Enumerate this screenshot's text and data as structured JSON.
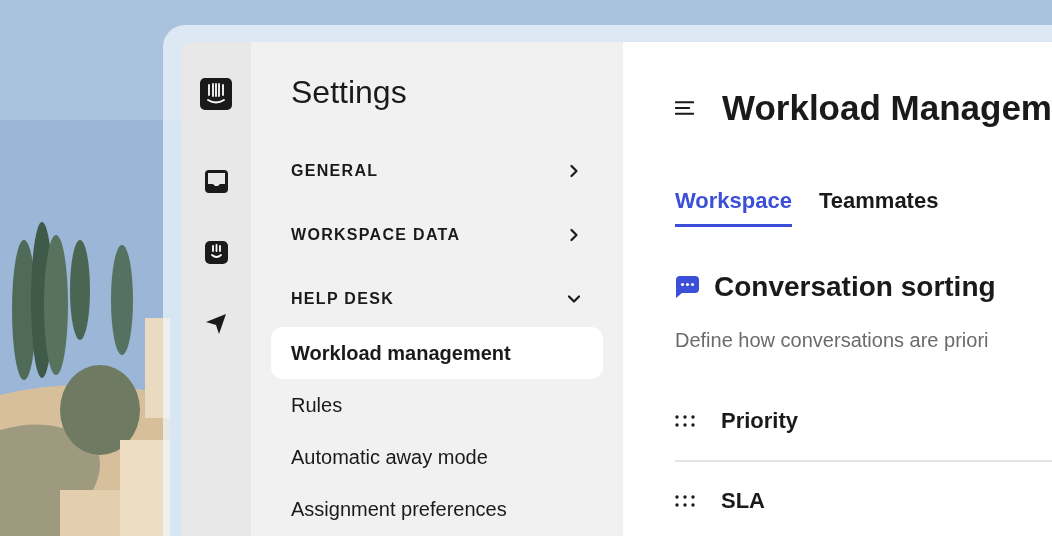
{
  "settings": {
    "title": "Settings",
    "sections": [
      {
        "label": "GENERAL",
        "expanded": false
      },
      {
        "label": "WORKSPACE DATA",
        "expanded": false
      },
      {
        "label": "HELP DESK",
        "expanded": true,
        "items": [
          {
            "label": "Workload management",
            "selected": true
          },
          {
            "label": "Rules",
            "selected": false
          },
          {
            "label": "Automatic away mode",
            "selected": false
          },
          {
            "label": "Assignment preferences",
            "selected": false
          }
        ]
      }
    ]
  },
  "main": {
    "title": "Workload Managem",
    "tabs": [
      {
        "label": "Workspace",
        "selected": true
      },
      {
        "label": "Teammates",
        "selected": false
      }
    ],
    "section": {
      "title": "Conversation sorting",
      "description": "Define how conversations are priori",
      "rows": [
        {
          "label": "Priority"
        },
        {
          "label": "SLA"
        }
      ]
    }
  }
}
